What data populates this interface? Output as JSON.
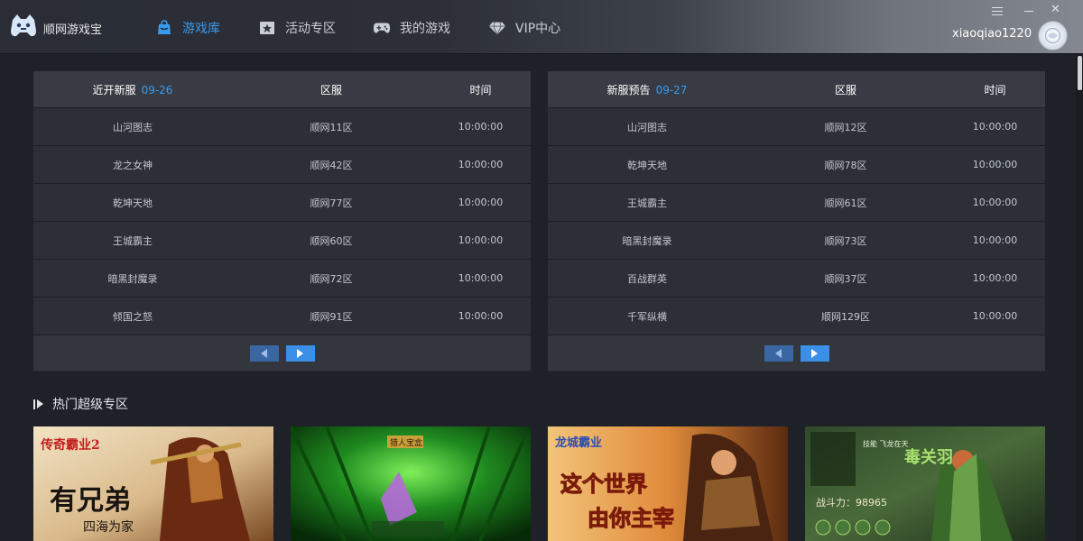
{
  "app": {
    "name": "顺网游戏宝"
  },
  "nav": [
    {
      "label": "游戏库",
      "icon": "bag-icon",
      "active": true
    },
    {
      "label": "活动专区",
      "icon": "star-box-icon",
      "active": false
    },
    {
      "label": "我的游戏",
      "icon": "gamepad-icon",
      "active": false
    },
    {
      "label": "VIP中心",
      "icon": "diamond-icon",
      "active": false
    }
  ],
  "user": {
    "name": "xiaoqiao1220"
  },
  "window_controls": {
    "menu": "menu-icon",
    "minimize": "minimize-icon",
    "close": "✕"
  },
  "new_servers": {
    "title": "近开新服",
    "date": "09-26",
    "col_server": "区服",
    "col_time": "时间",
    "rows": [
      {
        "game": "山河图志",
        "server": "顺网11区",
        "time": "10:00:00"
      },
      {
        "game": "龙之女神",
        "server": "顺网42区",
        "time": "10:00:00"
      },
      {
        "game": "乾坤天地",
        "server": "顺网77区",
        "time": "10:00:00"
      },
      {
        "game": "王城霸主",
        "server": "顺网60区",
        "time": "10:00:00"
      },
      {
        "game": "暗黑封魔录",
        "server": "顺网72区",
        "time": "10:00:00"
      },
      {
        "game": "倾国之怒",
        "server": "顺网91区",
        "time": "10:00:00"
      }
    ]
  },
  "upcoming_servers": {
    "title": "新服预告",
    "date": "09-27",
    "col_server": "区服",
    "col_time": "时间",
    "rows": [
      {
        "game": "山河图志",
        "server": "顺网12区",
        "time": "10:00:00"
      },
      {
        "game": "乾坤天地",
        "server": "顺网78区",
        "time": "10:00:00"
      },
      {
        "game": "王城霸主",
        "server": "顺网61区",
        "time": "10:00:00"
      },
      {
        "game": "暗黑封魔录",
        "server": "顺网73区",
        "time": "10:00:00"
      },
      {
        "game": "百战群英",
        "server": "顺网37区",
        "time": "10:00:00"
      },
      {
        "game": "千军纵横",
        "server": "顺网129区",
        "time": "10:00:00"
      }
    ]
  },
  "hot_section": {
    "title": "热门超级专区"
  },
  "cards": [
    {
      "logo_text": "传奇霸业2",
      "slogan": "有兄弟",
      "sub": "四海为家",
      "accent": "#c8a060"
    },
    {
      "logo_text": "猎人宝盒",
      "accent": "#3fbf3a"
    },
    {
      "logo_text": "龙城霸业",
      "slogan": "这个世界",
      "sub": "由你主宰",
      "accent": "#e08a3a"
    },
    {
      "slogan": "毒关羽",
      "stat": "战斗力：98965",
      "skill": "技能 飞龙在天",
      "accent": "#8fcf5f"
    }
  ]
}
